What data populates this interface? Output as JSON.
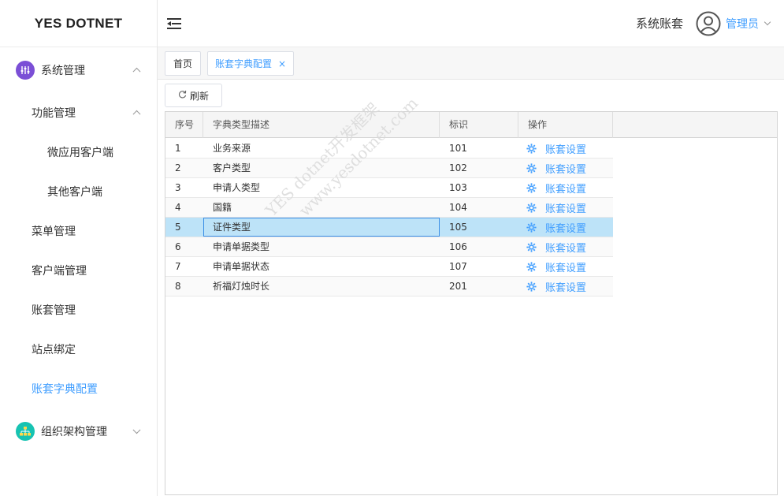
{
  "app": {
    "brand": "YES DOTNET"
  },
  "header": {
    "account_set_label": "系统账套",
    "user_name": "管理员"
  },
  "sidebar": {
    "items": [
      {
        "label": "系统管理",
        "icon": "sliders-icon",
        "expanded": true
      },
      {
        "label": "功能管理",
        "expanded": true
      },
      {
        "label": "微应用客户端"
      },
      {
        "label": "其他客户端"
      },
      {
        "label": "菜单管理"
      },
      {
        "label": "客户端管理"
      },
      {
        "label": "账套管理"
      },
      {
        "label": "站点绑定"
      },
      {
        "label": "账套字典配置",
        "active": true
      },
      {
        "label": "组织架构管理",
        "icon": "org-chart-icon",
        "expanded": false
      }
    ]
  },
  "tabs": [
    {
      "label": "首页"
    },
    {
      "label": "账套字典配置",
      "active": true,
      "close": "×"
    }
  ],
  "toolbar": {
    "refresh_label": "刷新"
  },
  "grid": {
    "columns": [
      "序号",
      "字典类型描述",
      "标识",
      "操作"
    ],
    "action_label": "账套设置",
    "rows": [
      {
        "no": "1",
        "desc": "业务来源",
        "code": "101"
      },
      {
        "no": "2",
        "desc": "客户类型",
        "code": "102"
      },
      {
        "no": "3",
        "desc": "申请人类型",
        "code": "103"
      },
      {
        "no": "4",
        "desc": "国籍",
        "code": "104"
      },
      {
        "no": "5",
        "desc": "证件类型",
        "code": "105",
        "selected": true
      },
      {
        "no": "6",
        "desc": "申请单据类型",
        "code": "106"
      },
      {
        "no": "7",
        "desc": "申请单据状态",
        "code": "107"
      },
      {
        "no": "8",
        "desc": "祈福灯烛时长",
        "code": "201"
      }
    ]
  },
  "watermark": {
    "line1": "YES dotnet开发框架",
    "line2": "www.yesdotnet.com"
  },
  "colors": {
    "accent": "#409eff",
    "selected_row": "#bde3f8",
    "purple_icon": "#7b4fd6",
    "teal_icon": "#17c3b2"
  }
}
